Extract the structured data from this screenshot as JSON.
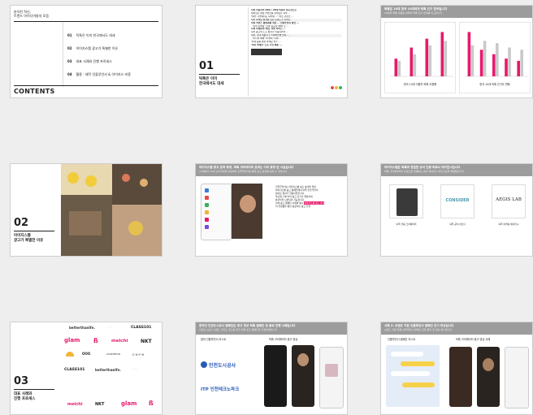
{
  "slides": {
    "s1": {
      "subtitle": "분석된 혁신,\n트렌드 아이디어들의 모음",
      "contents": "CONTENTS",
      "items": [
        {
          "num": "01",
          "text": "틱톡은 이미 한국에서도 대세"
        },
        {
          "num": "02",
          "text": "아이지스팸 광고가 특별한 이유"
        },
        {
          "num": "03",
          "text": "대표 사례와 진행 프로세스"
        },
        {
          "num": "04",
          "text": "활용 : 제작 인플루언서 & 아이지스 비용"
        }
      ]
    },
    "s2": {
      "num": "01",
      "title": "틱톡은 이미\n한국에서도 대세",
      "doc_lines": [
        "틱톡 이용자의 10대 / 20대 비중이 높은것으로",
        "    재미있는 영상 컨텐츠를 찾아보는 틱톡 …",
        "    \"패션 기업에서도 틱톡에 …\" 바로 콘텐츠 …",
        "   틱톡 마케팅 효과를 보는 브랜드가 늘어나",
        "틱톡 커머스 활성화를 위한 … 인플루언서 협업 …",
        "    ·  '틱톡 마케팅' 현재 '중요한 매체' 로 …",
        "틱톡 마케팅의 핵심, 틱톡 커머스 …",
        "    틱톡 광고의 노출 효과가 입증되면서 …",
        "틱톡, 국내 이용자 수 1000만명 돌파 …",
        "    ·  '미디어 매체' 의 변화, 이제 …",
        "    '이제 숏폼 영상 마케팅 필수' …",
        "    '틱톡 마케팅' 으로 기업 매출 …"
      ]
    },
    "s3": {
      "header_title": "틱톡은 10대 한국 10대에게 틱톡 인기 한국입니다",
      "header_sub": "10대의 틱톡 이용률 변화와 틱톡 인기 변화를 비교합니다",
      "chart_data": [
        {
          "type": "bar",
          "title": "",
          "caption": "한국 10대 이용자 틱톡 이용률",
          "categories": [
            "1",
            "2",
            "3",
            "4"
          ],
          "series": [
            {
              "name": "",
              "color": "#e8196c",
              "values": [
                40,
                65,
                85,
                100
              ]
            },
            {
              "name": "",
              "color": "#c9c9c9",
              "values": [
                35,
                50,
                70,
                80
              ]
            }
          ],
          "ylim": [
            0,
            110
          ]
        },
        {
          "type": "bar",
          "title": "",
          "caption": "한국 10대 틱톡 인기도 변화",
          "categories": [
            "1",
            "2",
            "3",
            "4",
            "5"
          ],
          "series": [
            {
              "name": "",
              "color": "#e8196c",
              "values": [
                100,
                60,
                50,
                40,
                35
              ]
            },
            {
              "name": "",
              "color": "#c9c9c9",
              "values": [
                70,
                80,
                75,
                65,
                60
              ]
            }
          ],
          "ylim": [
            0,
            110
          ]
        }
      ]
    },
    "s4": {
      "num": "02",
      "title": "아이지스팸\n광고가 특별한 이유"
    },
    "s5": {
      "header_title": "아이지스팸 광고 효과 증명, 틱톡 크리에이터 효과는 이미 증명 된 사실입니다",
      "header_sub": "10대에서 20대 소비자에게 어필하여 인플루언서를 통해 광고 효과를 높일 수 있습니다",
      "lines": [
        "인플루언서는 아이지스팸 광고 효과의 핵심",
        "아이지스팸 광고 캠페인에서 틱톡 인플루언서",
        "참여로 효과가 입증되었습니다.",
        "팔로워 수에 따라 광고 단가가 결정되며",
        "효과적인 브랜딩이 가능합니다.",
        "실제 광고 캠페인 사례와 예시",
        "이 플랫폼을 통한 성공적인 광고 진행"
      ],
      "highlight": "아이지스팸 광고 효과"
    },
    "s6": {
      "header_title": "아이지스팸은 틱톡과 협업한 공식 인증 파트너 에이전시입니다",
      "header_sub": "틱톡 크리에이터와 브랜드를 연결하는 공식 에이전시 파트너십을 체결했습니다",
      "brand2": "CONSIDER",
      "brand3": "AEGIS LAB",
      "captions": [
        "틱톡 인증 크리에이터",
        "틱톡 공식 파트너",
        "틱톡 마케팅 에이전시"
      ]
    },
    "s7": {
      "num": "03",
      "title": "대표 사례와\n진행 프로세스",
      "logos": [
        "betterthanIfe.",
        "CLASS101",
        "glam",
        "melchi",
        "NKT",
        "OOO",
        "unadena",
        "CLASS101",
        "betterthanIfe.",
        "melchi",
        "NKT",
        "glam"
      ]
    },
    "s8": {
      "header_title": "한국인 인천도시공사 캠페인은 광고 영상 틱톡 캠페인 및 홍보 진행 사례입니다",
      "header_sub": "인천도시공사 브랜드 인지도 제고를 위한 틱톡 광고 캠페인을 진행하였습니다",
      "left_title": "참여 인플루언서 리스트",
      "right_title": "틱톡 크리에이터 광고 영상",
      "brand1": "인천도시공사",
      "brand2": "ITP 인천테크노파크"
    },
    "s9": {
      "header_title": "사례 2: 브랜드 지원 인플루언서 캠페인 인기 영상입니다",
      "header_sub": "브랜드 지원 틱톡 인플루언서 캠페인 진행 결과 및 영상 예시입니다",
      "left_title": "인플루언서 캠페인 리스트",
      "right_title": "틱톡 크리에이터 광고 영상 사례"
    }
  }
}
